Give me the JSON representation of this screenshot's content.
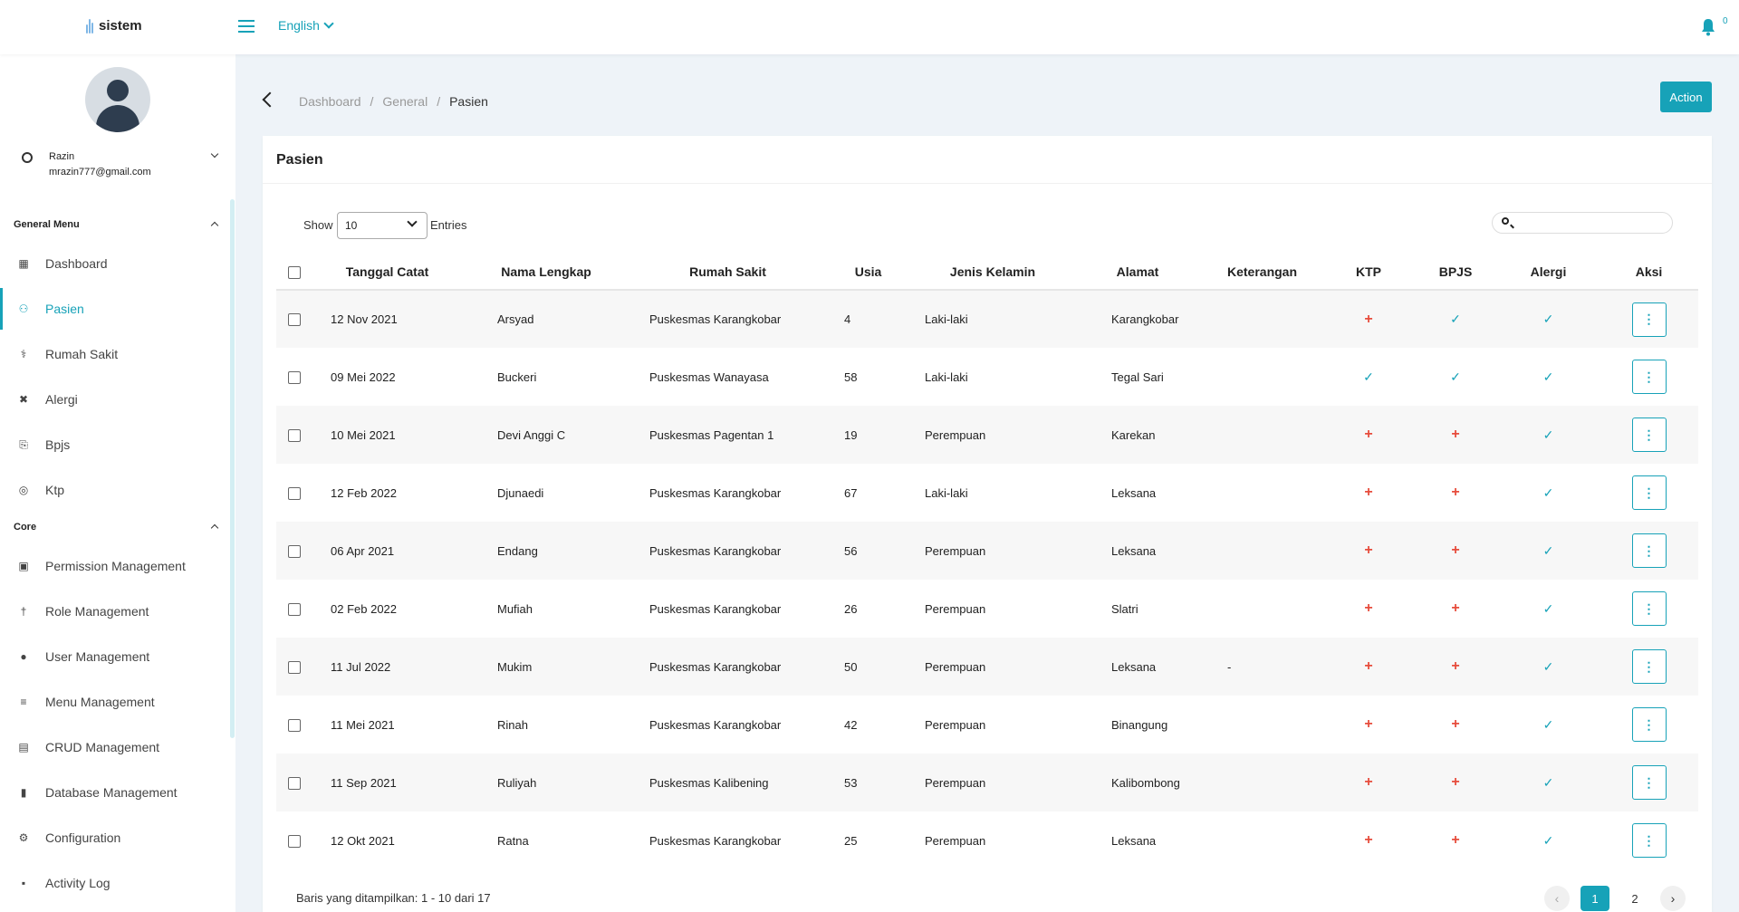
{
  "app": {
    "logo_text": "sistem",
    "language": "English",
    "notification_count": "0"
  },
  "user": {
    "name": "Razin",
    "email": "mrazin777@gmail.com"
  },
  "sidebar": {
    "general_title": "General Menu",
    "core_title": "Core",
    "general_items": [
      {
        "label": "Dashboard",
        "icon": "dashboard-icon"
      },
      {
        "label": "Pasien",
        "icon": "users-icon",
        "active": true
      },
      {
        "label": "Rumah Sakit",
        "icon": "hospital-icon"
      },
      {
        "label": "Alergi",
        "icon": "allergy-icon"
      },
      {
        "label": "Bpjs",
        "icon": "paperclip-icon"
      },
      {
        "label": "Ktp",
        "icon": "fingerprint-icon"
      }
    ],
    "core_items": [
      {
        "label": "Permission Management",
        "icon": "lock-icon"
      },
      {
        "label": "Role Management",
        "icon": "person-icon"
      },
      {
        "label": "User Management",
        "icon": "user-icon"
      },
      {
        "label": "Menu Management",
        "icon": "menu-icon"
      },
      {
        "label": "CRUD Management",
        "icon": "table-icon"
      },
      {
        "label": "Database Management",
        "icon": "database-icon"
      },
      {
        "label": "Configuration",
        "icon": "gear-icon"
      },
      {
        "label": "Activity Log",
        "icon": "log-icon"
      }
    ]
  },
  "breadcrumb": {
    "items": [
      "Dashboard",
      "General"
    ],
    "current": "Pasien"
  },
  "action_label": "Action",
  "card": {
    "title": "Pasien",
    "show_label": "Show",
    "entries_value": "10",
    "entries_label": "Entries",
    "search_placeholder": ""
  },
  "table": {
    "headers": [
      "Tanggal Catat",
      "Nama Lengkap",
      "Rumah Sakit",
      "Usia",
      "Jenis Kelamin",
      "Alamat",
      "Keterangan",
      "KTP",
      "BPJS",
      "Alergi",
      "Aksi"
    ],
    "rows": [
      {
        "tanggal": "12 Nov 2021",
        "nama": "Arsyad",
        "rs": "Puskesmas Karangkobar",
        "usia": "4",
        "jk": "Laki-laki",
        "alamat": "Karangkobar",
        "ket": "",
        "ktp": false,
        "bpjs": true,
        "alergi": true
      },
      {
        "tanggal": "09 Mei 2022",
        "nama": "Buckeri",
        "rs": "Puskesmas Wanayasa",
        "usia": "58",
        "jk": "Laki-laki",
        "alamat": "Tegal Sari",
        "ket": "",
        "ktp": true,
        "bpjs": true,
        "alergi": true
      },
      {
        "tanggal": "10 Mei 2021",
        "nama": "Devi Anggi C",
        "rs": "Puskesmas Pagentan 1",
        "usia": "19",
        "jk": "Perempuan",
        "alamat": "Karekan",
        "ket": "",
        "ktp": false,
        "bpjs": false,
        "alergi": true
      },
      {
        "tanggal": "12 Feb 2022",
        "nama": "Djunaedi",
        "rs": "Puskesmas Karangkobar",
        "usia": "67",
        "jk": "Laki-laki",
        "alamat": "Leksana",
        "ket": "",
        "ktp": false,
        "bpjs": false,
        "alergi": true
      },
      {
        "tanggal": "06 Apr 2021",
        "nama": "Endang",
        "rs": "Puskesmas Karangkobar",
        "usia": "56",
        "jk": "Perempuan",
        "alamat": "Leksana",
        "ket": "",
        "ktp": false,
        "bpjs": false,
        "alergi": true
      },
      {
        "tanggal": "02 Feb 2022",
        "nama": "Mufiah",
        "rs": "Puskesmas Karangkobar",
        "usia": "26",
        "jk": "Perempuan",
        "alamat": "Slatri",
        "ket": "",
        "ktp": false,
        "bpjs": false,
        "alergi": true
      },
      {
        "tanggal": "11 Jul 2022",
        "nama": "Mukim",
        "rs": "Puskesmas Karangkobar",
        "usia": "50",
        "jk": "Perempuan",
        "alamat": "Leksana",
        "ket": "-",
        "ktp": false,
        "bpjs": false,
        "alergi": true
      },
      {
        "tanggal": "11 Mei 2021",
        "nama": "Rinah",
        "rs": "Puskesmas Karangkobar",
        "usia": "42",
        "jk": "Perempuan",
        "alamat": "Binangung",
        "ket": "",
        "ktp": false,
        "bpjs": false,
        "alergi": true
      },
      {
        "tanggal": "11 Sep 2021",
        "nama": "Ruliyah",
        "rs": "Puskesmas Kalibening",
        "usia": "53",
        "jk": "Perempuan",
        "alamat": "Kalibombong",
        "ket": "",
        "ktp": false,
        "bpjs": false,
        "alergi": true
      },
      {
        "tanggal": "12 Okt 2021",
        "nama": "Ratna",
        "rs": "Puskesmas Karangkobar",
        "usia": "25",
        "jk": "Perempuan",
        "alamat": "Leksana",
        "ket": "",
        "ktp": false,
        "bpjs": false,
        "alergi": true
      }
    ]
  },
  "footer": {
    "info": "Baris yang ditampilkan: 1 - 10 dari 17",
    "pages": [
      "1",
      "2"
    ],
    "current_page": "1"
  },
  "colors": {
    "accent": "#17a2b8",
    "negative": "#e74c3c"
  }
}
